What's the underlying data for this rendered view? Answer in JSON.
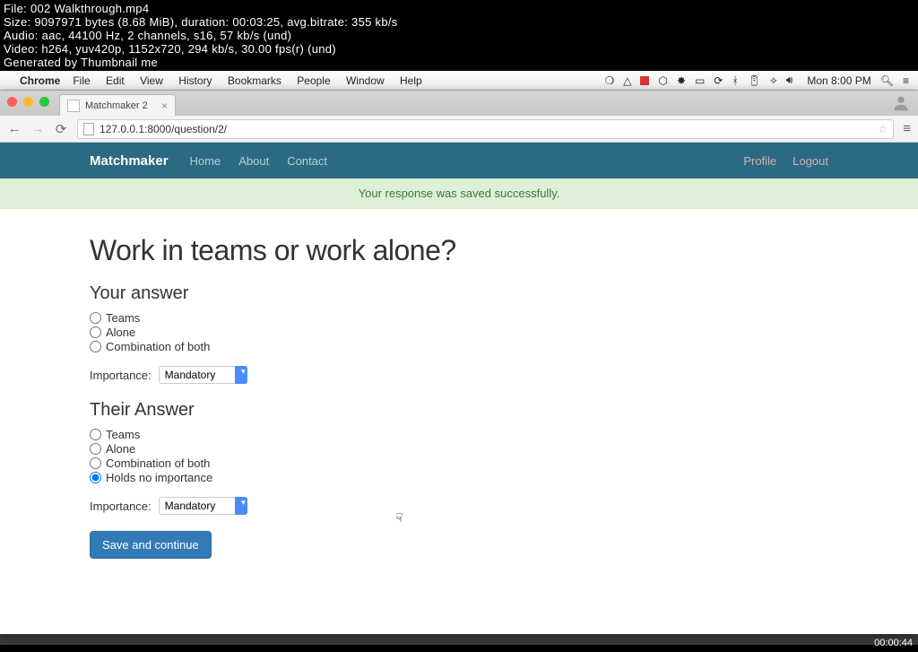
{
  "overlay": {
    "file": "File: 002 Walkthrough.mp4",
    "size": "Size: 9097971 bytes (8.68 MiB), duration: 00:03:25, avg.bitrate: 355 kb/s",
    "audio": "Audio: aac, 44100 Hz, 2 channels, s16, 57 kb/s (und)",
    "video": "Video: h264, yuv420p, 1152x720, 294 kb/s, 30.00 fps(r) (und)",
    "gen": "Generated by Thumbnail me",
    "timestamp": "00:00:44"
  },
  "mac": {
    "app": "Chrome",
    "menus": [
      "File",
      "Edit",
      "View",
      "History",
      "Bookmarks",
      "People",
      "Window",
      "Help"
    ],
    "clock": "Mon 8:00 PM"
  },
  "chrome": {
    "tab_title": "Matchmaker 2",
    "url": "127.0.0.1:8000/question/2/"
  },
  "nav": {
    "brand": "Matchmaker",
    "links": [
      "Home",
      "About",
      "Contact"
    ],
    "right": [
      "Profile",
      "Logout"
    ]
  },
  "alert": "Your response was saved successfully.",
  "question": "Work in teams or work alone?",
  "your_answer": {
    "heading": "Your answer",
    "options": [
      "Teams",
      "Alone",
      "Combination of both"
    ],
    "importance_label": "Importance:",
    "importance_value": "Mandatory"
  },
  "their_answer": {
    "heading": "Their Answer",
    "options": [
      "Teams",
      "Alone",
      "Combination of both",
      "Holds no importance"
    ],
    "selected_index": 3,
    "importance_label": "Importance:",
    "importance_value": "Mandatory"
  },
  "submit": "Save and continue"
}
